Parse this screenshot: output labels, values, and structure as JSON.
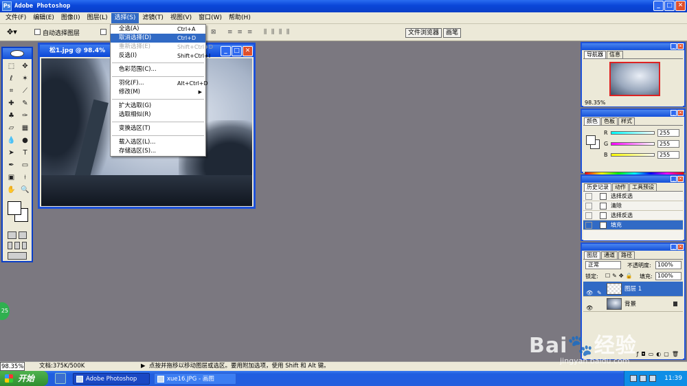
{
  "window": {
    "title": "Adobe Photoshop"
  },
  "menubar": [
    "文件(F)",
    "编辑(E)",
    "图像(I)",
    "图层(L)",
    "选择(S)",
    "滤镜(T)",
    "视图(V)",
    "窗口(W)",
    "帮助(H)"
  ],
  "options": {
    "auto_select_layer": "自动选择图层",
    "palette_well_tabs": [
      "文件浏览器",
      "画笔"
    ]
  },
  "select_menu": {
    "items": [
      {
        "label": "全选(A)",
        "shortcut": "Ctrl+A"
      },
      {
        "label": "取消选择(D)",
        "shortcut": "Ctrl+D"
      },
      {
        "label": "重新选择(E)",
        "shortcut": "Shift+Ctrl+D"
      },
      {
        "label": "反选(I)",
        "shortcut": "Shift+Ctrl+I"
      },
      {
        "label": "色彩范围(C)..."
      },
      {
        "label": "羽化(F)...",
        "shortcut": "Alt+Ctrl+D"
      },
      {
        "label": "修改(M)"
      },
      {
        "label": "扩大选取(G)"
      },
      {
        "label": "选取相似(R)"
      },
      {
        "label": "变换选区(T)"
      },
      {
        "label": "载入选区(L)..."
      },
      {
        "label": "存储选区(S)..."
      }
    ]
  },
  "document": {
    "title": "松1.jpg @ 98.4%"
  },
  "navigator": {
    "tabs": [
      "导航器",
      "信息"
    ],
    "zoom": "98.35%"
  },
  "color_panel": {
    "tabs": [
      "颜色",
      "色板",
      "样式"
    ],
    "channels": [
      {
        "name": "R",
        "value": "255"
      },
      {
        "name": "G",
        "value": "255"
      },
      {
        "name": "B",
        "value": "255"
      }
    ]
  },
  "history": {
    "tabs": [
      "历史记录",
      "动作",
      "工具预设"
    ],
    "items": [
      "选择反选",
      "清除",
      "选择反选",
      "填充"
    ]
  },
  "layers": {
    "tabs": [
      "图层",
      "通道",
      "路径"
    ],
    "blend_mode": "正常",
    "opacity_label": "不透明度:",
    "opacity": "100%",
    "lock_label": "锁定:",
    "fill_label": "填充:",
    "fill": "100%",
    "items": [
      "图层 1",
      "背景"
    ]
  },
  "statusbar": {
    "zoom": "98.35%",
    "doc_size": "文档:375K/500K",
    "tip": "点按并拖移以移动图层或选区。要用附加选项，使用 Shift 和 Alt 键。"
  },
  "taskbar": {
    "start": "开始",
    "tasks": [
      "Adobe Photoshop",
      "xue16.JPG - 画图"
    ],
    "clock": "11:39"
  },
  "overlay": {
    "badge": "25",
    "watermark_brand": "Bai🐾经验",
    "watermark_url": "jingyan.baidu.com"
  },
  "colors": {
    "titlebar": "#0a46d8",
    "menu_highlight": "#316ac5",
    "workspace": "#7b7880"
  }
}
